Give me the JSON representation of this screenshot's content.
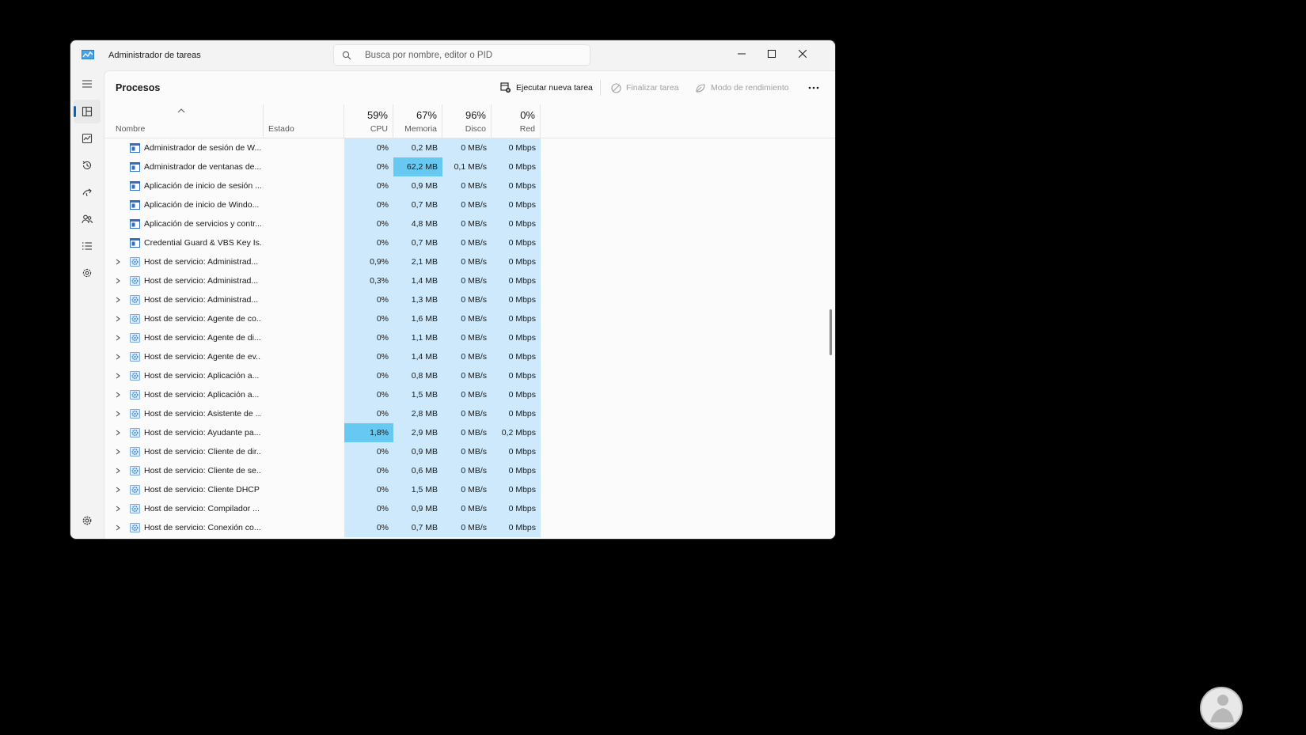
{
  "window": {
    "title": "Administrador de tareas",
    "search_placeholder": "Busca por nombre, editor o PID"
  },
  "sidebar": {
    "items": [
      {
        "icon": "hamburger-menu-icon"
      },
      {
        "icon": "processes-icon",
        "active": true
      },
      {
        "icon": "performance-icon"
      },
      {
        "icon": "app-history-icon"
      },
      {
        "icon": "startup-apps-icon"
      },
      {
        "icon": "users-icon"
      },
      {
        "icon": "details-icon"
      },
      {
        "icon": "services-icon"
      },
      {
        "icon": "settings-icon"
      }
    ]
  },
  "toolbar": {
    "page_title": "Procesos",
    "run_new_task": "Ejecutar nueva tarea",
    "end_task": "Finalizar tarea",
    "efficiency_mode": "Modo de rendimiento"
  },
  "headers": {
    "name": "Nombre",
    "status": "Estado",
    "cpu_pct": "59%",
    "cpu_label": "CPU",
    "mem_pct": "67%",
    "mem_label": "Memoria",
    "disk_pct": "96%",
    "disk_label": "Disco",
    "net_pct": "0%",
    "net_label": "Red"
  },
  "colors": {
    "metric_bg": "#cde9fb",
    "metric_hot": "#67c8f2",
    "accent": "#0067c0"
  },
  "processes": [
    {
      "name": "Administrador de sesión de W...",
      "icon": "window-icon",
      "expandable": false,
      "cpu": "0%",
      "mem": "0,2 MB",
      "disk": "0 MB/s",
      "net": "0 Mbps"
    },
    {
      "name": "Administrador de ventanas de...",
      "icon": "window-icon",
      "expandable": false,
      "cpu": "0%",
      "mem": "62,2 MB",
      "disk": "0,1 MB/s",
      "net": "0 Mbps",
      "hot": "mem"
    },
    {
      "name": "Aplicación de inicio de sesión ...",
      "icon": "window-icon",
      "expandable": false,
      "cpu": "0%",
      "mem": "0,9 MB",
      "disk": "0 MB/s",
      "net": "0 Mbps"
    },
    {
      "name": "Aplicación de inicio de Windo...",
      "icon": "window-icon",
      "expandable": false,
      "cpu": "0%",
      "mem": "0,7 MB",
      "disk": "0 MB/s",
      "net": "0 Mbps"
    },
    {
      "name": "Aplicación de servicios y contr...",
      "icon": "window-icon",
      "expandable": false,
      "cpu": "0%",
      "mem": "4,8 MB",
      "disk": "0 MB/s",
      "net": "0 Mbps"
    },
    {
      "name": "Credential Guard & VBS Key Is...",
      "icon": "window-icon",
      "expandable": false,
      "cpu": "0%",
      "mem": "0,7 MB",
      "disk": "0 MB/s",
      "net": "0 Mbps"
    },
    {
      "name": "Host de servicio: Administrad...",
      "icon": "service-gear-icon",
      "expandable": true,
      "cpu": "0,9%",
      "mem": "2,1 MB",
      "disk": "0 MB/s",
      "net": "0 Mbps"
    },
    {
      "name": "Host de servicio: Administrad...",
      "icon": "service-gear-icon",
      "expandable": true,
      "cpu": "0,3%",
      "mem": "1,4 MB",
      "disk": "0 MB/s",
      "net": "0 Mbps"
    },
    {
      "name": "Host de servicio: Administrad...",
      "icon": "service-gear-icon",
      "expandable": true,
      "cpu": "0%",
      "mem": "1,3 MB",
      "disk": "0 MB/s",
      "net": "0 Mbps"
    },
    {
      "name": "Host de servicio: Agente de co...",
      "icon": "service-gear-icon",
      "expandable": true,
      "cpu": "0%",
      "mem": "1,6 MB",
      "disk": "0 MB/s",
      "net": "0 Mbps"
    },
    {
      "name": "Host de servicio: Agente de di...",
      "icon": "service-gear-icon",
      "expandable": true,
      "cpu": "0%",
      "mem": "1,1 MB",
      "disk": "0 MB/s",
      "net": "0 Mbps"
    },
    {
      "name": "Host de servicio: Agente de ev...",
      "icon": "service-gear-icon",
      "expandable": true,
      "cpu": "0%",
      "mem": "1,4 MB",
      "disk": "0 MB/s",
      "net": "0 Mbps"
    },
    {
      "name": "Host de servicio: Aplicación a...",
      "icon": "service-gear-icon",
      "expandable": true,
      "cpu": "0%",
      "mem": "0,8 MB",
      "disk": "0 MB/s",
      "net": "0 Mbps"
    },
    {
      "name": "Host de servicio: Aplicación a...",
      "icon": "service-gear-icon",
      "expandable": true,
      "cpu": "0%",
      "mem": "1,5 MB",
      "disk": "0 MB/s",
      "net": "0 Mbps"
    },
    {
      "name": "Host de servicio: Asistente de ...",
      "icon": "service-gear-icon",
      "expandable": true,
      "cpu": "0%",
      "mem": "2,8 MB",
      "disk": "0 MB/s",
      "net": "0 Mbps"
    },
    {
      "name": "Host de servicio: Ayudante pa...",
      "icon": "service-gear-icon",
      "expandable": true,
      "cpu": "1,8%",
      "mem": "2,9 MB",
      "disk": "0 MB/s",
      "net": "0,2 Mbps",
      "hot": "cpu"
    },
    {
      "name": "Host de servicio: Cliente de dir...",
      "icon": "service-gear-icon",
      "expandable": true,
      "cpu": "0%",
      "mem": "0,9 MB",
      "disk": "0 MB/s",
      "net": "0 Mbps"
    },
    {
      "name": "Host de servicio: Cliente de se...",
      "icon": "service-gear-icon",
      "expandable": true,
      "cpu": "0%",
      "mem": "0,6 MB",
      "disk": "0 MB/s",
      "net": "0 Mbps"
    },
    {
      "name": "Host de servicio: Cliente DHCP",
      "icon": "service-gear-icon",
      "expandable": true,
      "cpu": "0%",
      "mem": "1,5 MB",
      "disk": "0 MB/s",
      "net": "0 Mbps"
    },
    {
      "name": "Host de servicio: Compilador ...",
      "icon": "service-gear-icon",
      "expandable": true,
      "cpu": "0%",
      "mem": "0,9 MB",
      "disk": "0 MB/s",
      "net": "0 Mbps"
    },
    {
      "name": "Host de servicio: Conexión co...",
      "icon": "service-gear-icon",
      "expandable": true,
      "cpu": "0%",
      "mem": "0,7 MB",
      "disk": "0 MB/s",
      "net": "0 Mbps"
    }
  ]
}
